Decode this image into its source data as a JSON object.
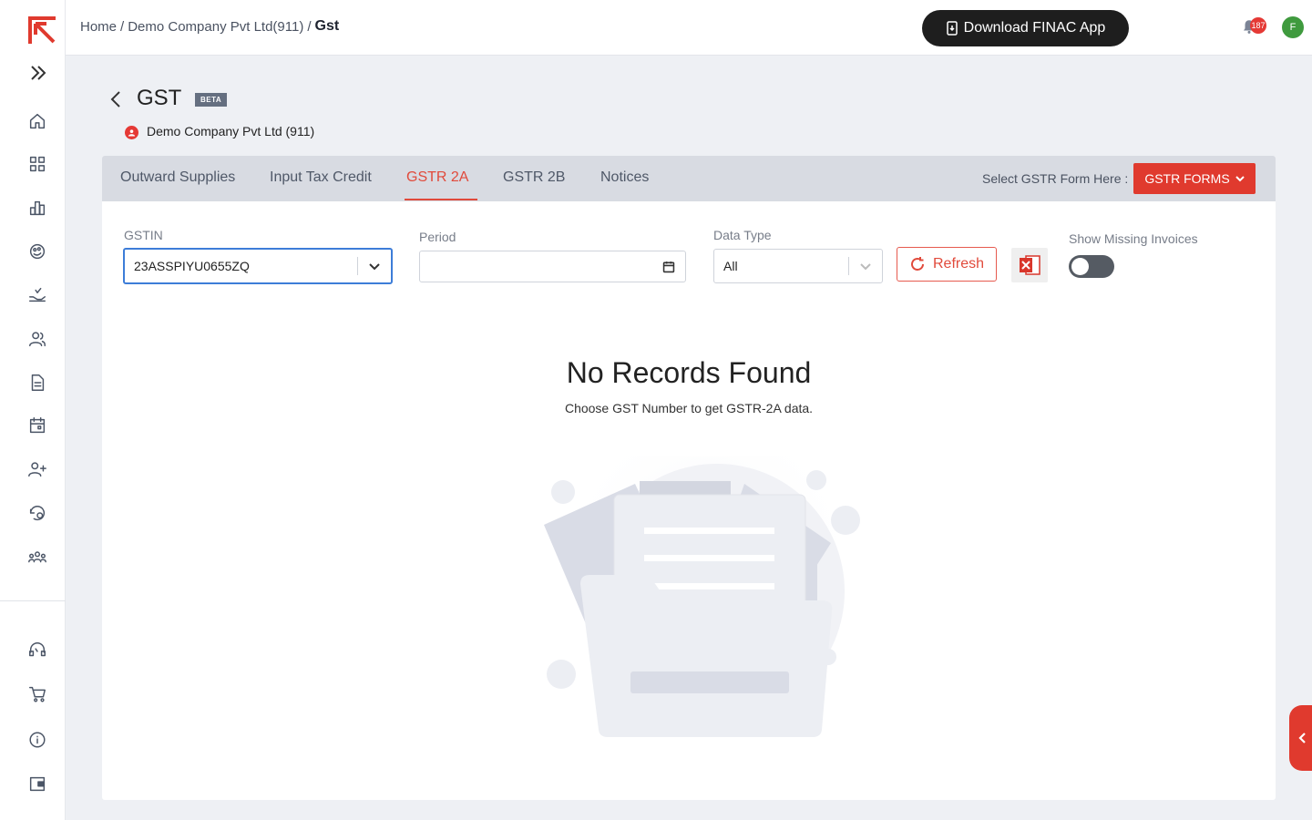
{
  "breadcrumb": {
    "home": "Home",
    "sep1": "/",
    "company": "Demo Company Pvt Ltd(911)",
    "sep2": "/",
    "current": "Gst"
  },
  "header": {
    "download_label": "Download FINAC App",
    "notification_count": "187",
    "avatar_initial": "F"
  },
  "page": {
    "title": "GST",
    "badge": "BETA",
    "company_name": "Demo Company Pvt Ltd (911)"
  },
  "tabs": [
    {
      "label": "Outward Supplies",
      "active": false
    },
    {
      "label": "Input Tax Credit",
      "active": false
    },
    {
      "label": "GSTR 2A",
      "active": true
    },
    {
      "label": "GSTR 2B",
      "active": false
    },
    {
      "label": "Notices",
      "active": false
    }
  ],
  "gstr_forms": {
    "prompt": "Select GSTR Form Here :",
    "button_label": "GSTR FORMS"
  },
  "filters": {
    "gstin_label": "GSTIN",
    "gstin_value": "23ASSPIYU0655ZQ",
    "period_label": "Period",
    "period_value": "",
    "data_type_label": "Data Type",
    "data_type_value": "All",
    "refresh_label": "Refresh",
    "show_missing_label": "Show Missing Invoices",
    "show_missing_on": false
  },
  "empty_state": {
    "title": "No Records Found",
    "subtitle": "Choose GST Number to get GSTR-2A data."
  },
  "colors": {
    "accent": "#e14a3b",
    "primary_button": "#e03a2e",
    "focus": "#3d7dd8"
  },
  "sidebar_icons": [
    "home-icon",
    "grid-icon",
    "bar-chart-icon",
    "palette-icon",
    "hand-money-icon",
    "users-icon",
    "document-icon",
    "calendar-icon",
    "add-user-icon",
    "settings-history-icon",
    "team-icon",
    "support-icon",
    "cart-icon",
    "info-icon",
    "wallet-icon"
  ]
}
